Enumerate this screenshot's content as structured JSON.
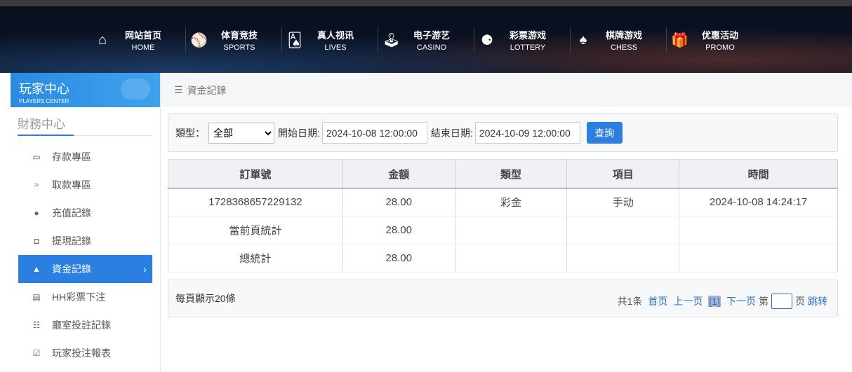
{
  "nav": [
    {
      "cn": "网站首页",
      "en": "HOME",
      "icon": "home-icon",
      "glyph": "⌂"
    },
    {
      "cn": "体育竞技",
      "en": "SPORTS",
      "icon": "ball-icon",
      "glyph": "⚾"
    },
    {
      "cn": "真人视讯",
      "en": "LIVES",
      "icon": "cards-icon",
      "glyph": "🂡"
    },
    {
      "cn": "电子游艺",
      "en": "CASINO",
      "icon": "joystick-icon",
      "glyph": "🕹"
    },
    {
      "cn": "彩票游戏",
      "en": "LOTTERY",
      "icon": "lottery-balls-icon",
      "glyph": "⚈"
    },
    {
      "cn": "棋牌游戏",
      "en": "CHESS",
      "icon": "spade-icon",
      "glyph": "♠"
    },
    {
      "cn": "优惠活动",
      "en": "PROMO",
      "icon": "gift-icon",
      "glyph": "🎁"
    }
  ],
  "sidebar": {
    "title": "玩家中心",
    "subtitle": "PLAYERS CENTER",
    "section": "財務中心",
    "items": [
      {
        "label": "存款專區",
        "icon": "card-icon",
        "glyph": "▭"
      },
      {
        "label": "取款專區",
        "icon": "cash-hand-icon",
        "glyph": "≈"
      },
      {
        "label": "充值記錄",
        "icon": "money-bag-icon",
        "glyph": "●"
      },
      {
        "label": "提現記錄",
        "icon": "wallet-icon",
        "glyph": "◘"
      },
      {
        "label": "資金記錄",
        "icon": "bank-icon",
        "glyph": "▲",
        "active": true
      },
      {
        "label": "HH彩票下注",
        "icon": "list-icon",
        "glyph": "▤"
      },
      {
        "label": "廳室投註記錄",
        "icon": "bullet-list-icon",
        "glyph": "☷"
      },
      {
        "label": "玩家投注報表",
        "icon": "chart-icon",
        "glyph": "☑"
      }
    ]
  },
  "breadcrumb": {
    "icon": "☰",
    "label": "資金記錄"
  },
  "filter": {
    "type_label": "類型：",
    "type_value": "全部",
    "start_label": "開始日期:",
    "start_value": "2024-10-08 12:00:00",
    "end_label": "結束日期:",
    "end_value": "2024-10-09 12:00:00",
    "query_label": "查詢"
  },
  "table": {
    "headers": [
      "訂單號",
      "金額",
      "類型",
      "項目",
      "時間"
    ],
    "rows": [
      [
        "1728368657229132",
        "28.00",
        "彩金",
        "手动",
        "2024-10-08 14:24:17"
      ],
      [
        "當前頁統計",
        "28.00",
        "",
        "",
        ""
      ],
      [
        "總統計",
        "28.00",
        "",
        "",
        ""
      ]
    ]
  },
  "footer": {
    "per_page": "每頁顯示20條",
    "total": "共1条",
    "first": "首页",
    "prev": "上一页",
    "current": "[1]",
    "next": "下一页",
    "page_prefix": "第",
    "page_suffix": "页",
    "jump": "跳转"
  },
  "colors": {
    "accent": "#2a7fe0"
  }
}
